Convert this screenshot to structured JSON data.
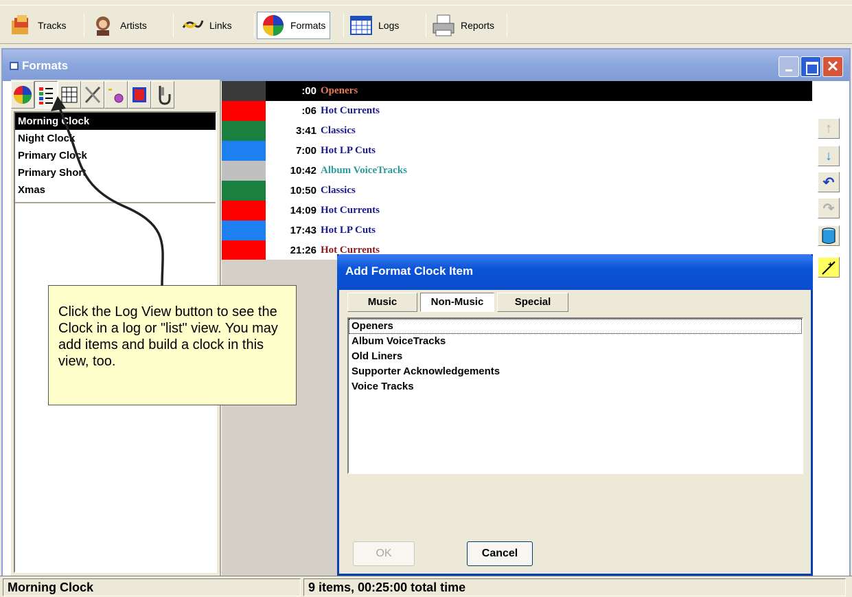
{
  "toolbar": {
    "items": [
      {
        "label": "Tracks",
        "icon": "tracks-icon"
      },
      {
        "label": "Artists",
        "icon": "artists-icon"
      },
      {
        "label": "Links",
        "icon": "links-icon"
      },
      {
        "label": "Formats",
        "icon": "formats-icon",
        "selected": true
      },
      {
        "label": "Logs",
        "icon": "logs-icon"
      },
      {
        "label": "Reports",
        "icon": "reports-icon"
      }
    ]
  },
  "window": {
    "title": "Formats"
  },
  "left_tools": [
    "pie-chart-icon",
    "log-view-icon",
    "grid-icon",
    "tools-icon",
    "rotation-icon",
    "color-icon",
    "hook-icon"
  ],
  "clocks": {
    "items": [
      "Morning Clock",
      "Night Clock",
      "Primary Clock",
      "Primary Short",
      "Xmas"
    ],
    "selected": "Morning Clock"
  },
  "log": {
    "rows": [
      {
        "time": ":00",
        "name": "Openers",
        "swatch": "#3a3a3a",
        "name_color": "#e87a5a",
        "row_bg": "#000000",
        "time_color": "#ffffff"
      },
      {
        "time": ":06",
        "name": "Hot Currents",
        "swatch": "#ff0000",
        "name_color": "#1a1a8c"
      },
      {
        "time": "3:41",
        "name": "Classics",
        "swatch": "#1a8040",
        "name_color": "#1a1a8c"
      },
      {
        "time": "7:00",
        "name": "Hot LP Cuts",
        "swatch": "#1e7ff0",
        "name_color": "#1a1a8c"
      },
      {
        "time": "10:42",
        "name": "Album VoiceTracks",
        "swatch": "#c0c0c0",
        "name_color": "#2a9a9a"
      },
      {
        "time": "10:50",
        "name": "Classics",
        "swatch": "#1a8040",
        "name_color": "#1a1a8c"
      },
      {
        "time": "14:09",
        "name": "Hot Currents",
        "swatch": "#ff0000",
        "name_color": "#1a1a8c"
      },
      {
        "time": "17:43",
        "name": "Hot LP Cuts",
        "swatch": "#1e7ff0",
        "name_color": "#1a1a8c"
      },
      {
        "time": "21:26",
        "name": "Hot Currents",
        "swatch": "#ff0000",
        "name_color": "#8c1a1a"
      }
    ]
  },
  "right_tools": [
    "move-up-icon",
    "move-down-icon",
    "undo-icon",
    "redo-icon",
    "delete-icon",
    "add-item-icon"
  ],
  "callout": {
    "text": "Click the Log View button to see the Clock in a log or \"list\" view.  You may add items and build a clock in this view, too."
  },
  "dialog": {
    "title": "Add Format Clock Item",
    "tabs": [
      "Music",
      "Non-Music",
      "Special"
    ],
    "selected_tab": "Non-Music",
    "items": [
      "Openers",
      "Album VoiceTracks",
      "Old Liners",
      "Supporter Acknowledgements",
      "Voice Tracks"
    ],
    "ok_label": "OK",
    "cancel_label": "Cancel"
  },
  "status": {
    "left": "Morning Clock",
    "right": "9 items,  00:25:00 total time"
  }
}
